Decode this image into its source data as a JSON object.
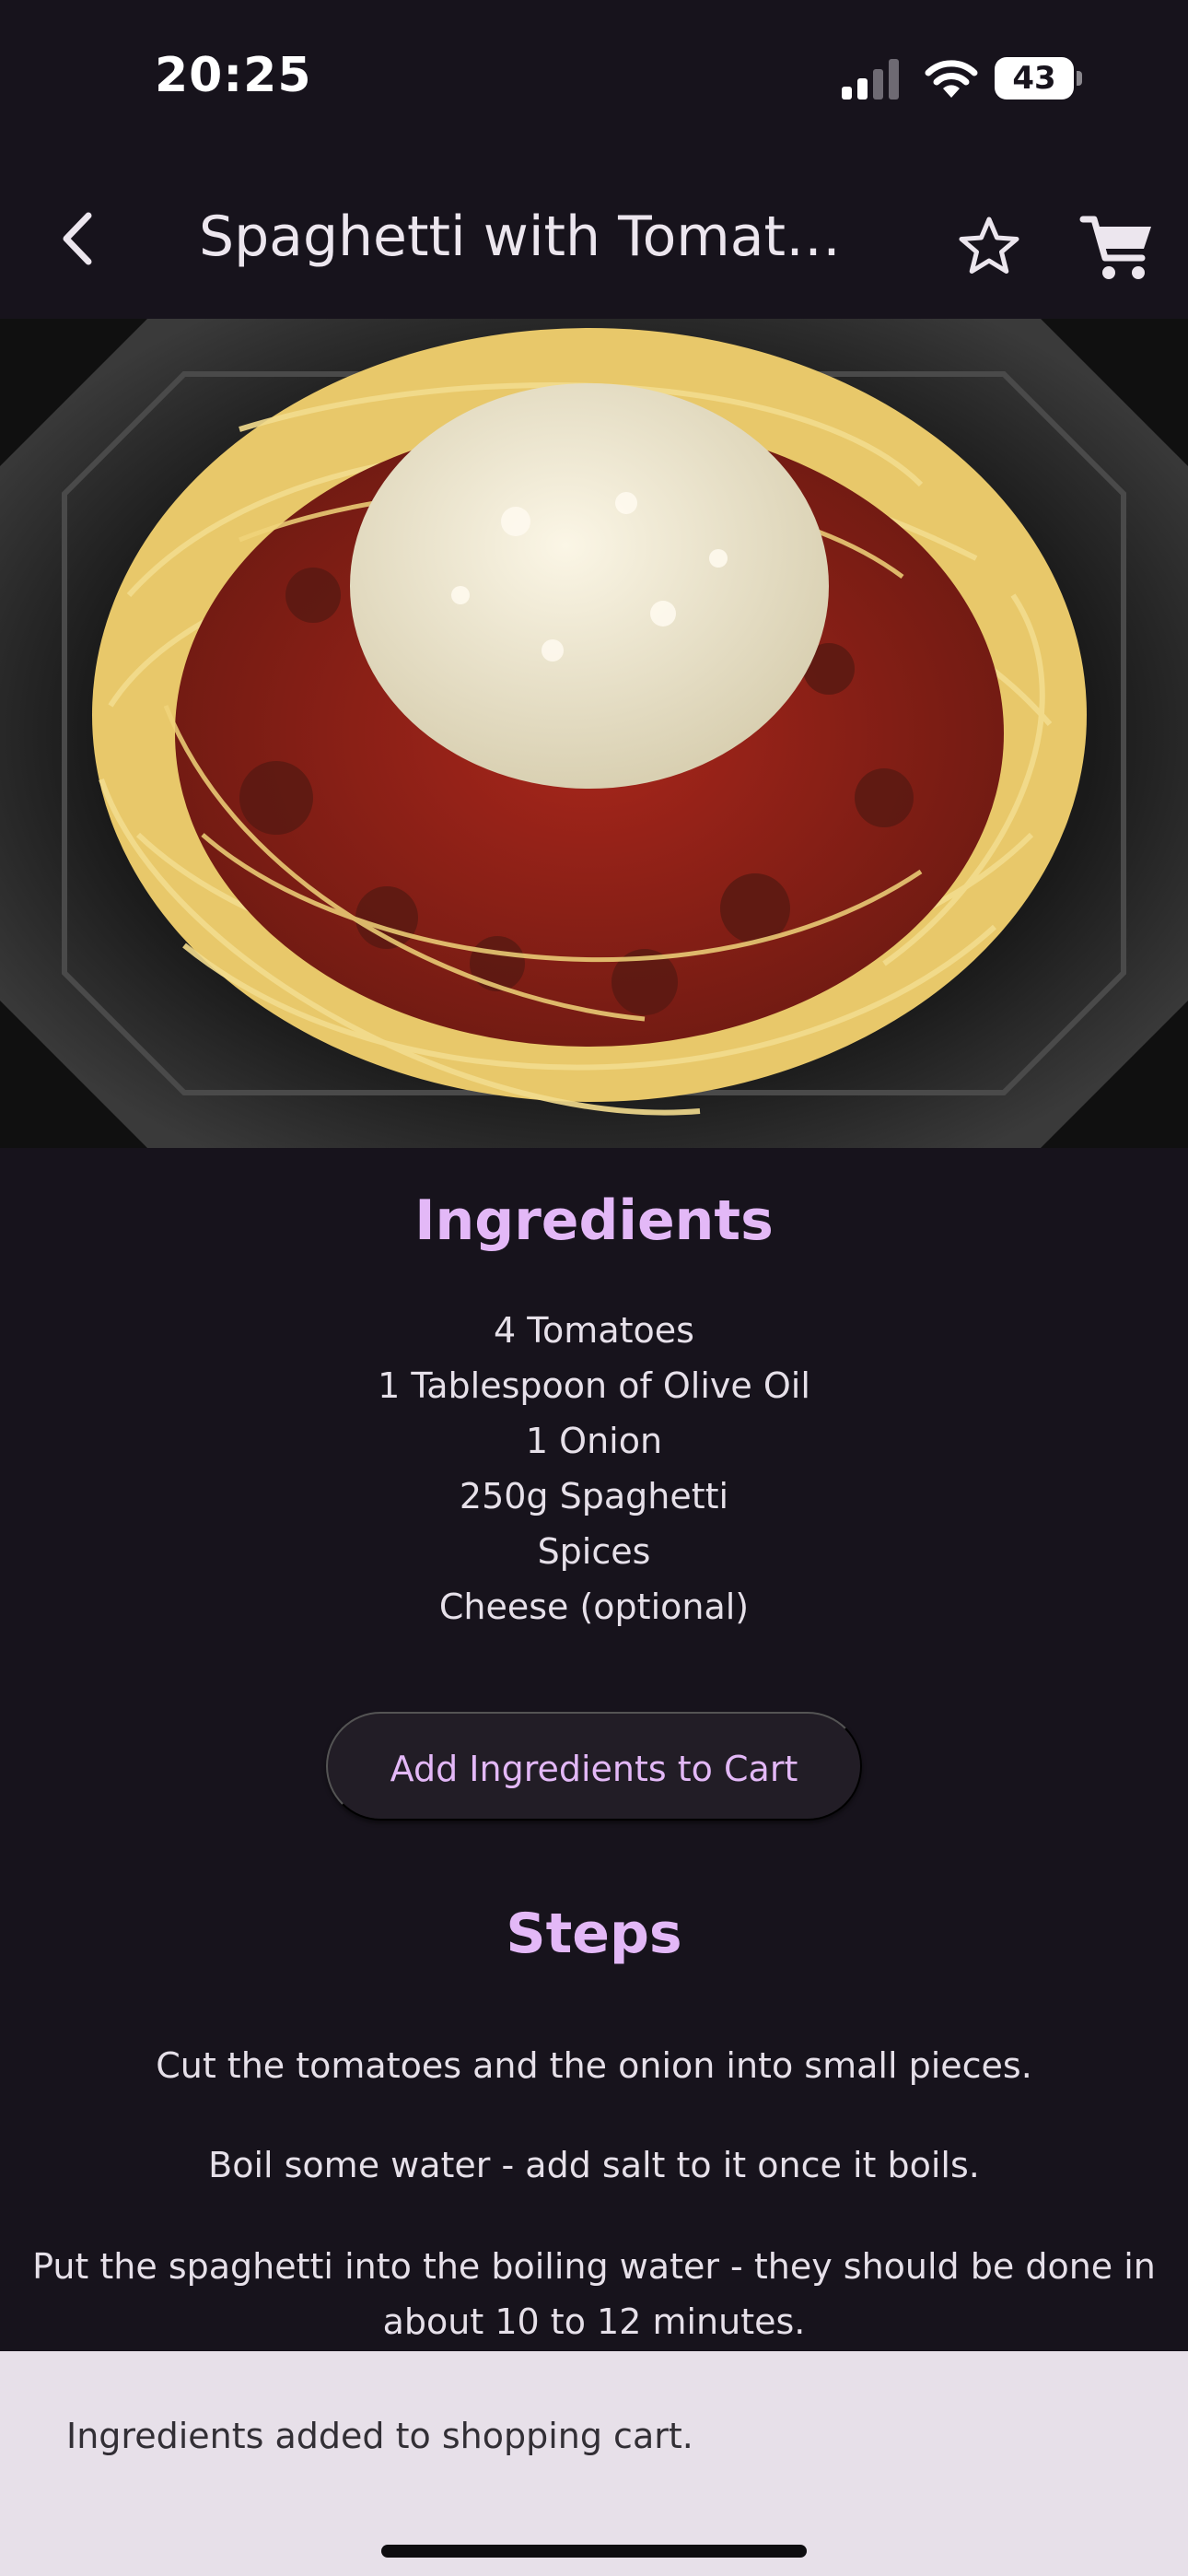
{
  "status_bar": {
    "time": "20:25",
    "battery_level": "43",
    "icons": [
      "signal-icon",
      "wifi-icon",
      "battery-icon"
    ]
  },
  "app_bar": {
    "title": "Spaghetti with Tomato …",
    "icons": [
      "back-arrow-icon",
      "star-outline-icon",
      "shopping-cart-icon"
    ]
  },
  "recipe": {
    "ingredients_heading": "Ingredients",
    "ingredients": [
      "4 Tomatoes",
      "1 Tablespoon of Olive Oil",
      "1 Onion",
      "250g Spaghetti",
      "Spices",
      "Cheese (optional)"
    ],
    "add_button_label": "Add Ingredients to Cart",
    "steps_heading": "Steps",
    "steps": [
      "Cut the tomatoes and the onion into small pieces.",
      "Boil some water - add salt to it once it boils.",
      "Put the spaghetti into the boiling water - they should be done in about 10 to 12 minutes."
    ]
  },
  "snackbar": {
    "message": "Ingredients added to shopping cart."
  },
  "colors": {
    "background": "#17131c",
    "accent": "#e3b8f7",
    "text": "#e6e0e9",
    "snackbar_bg": "#e7e0e9"
  }
}
